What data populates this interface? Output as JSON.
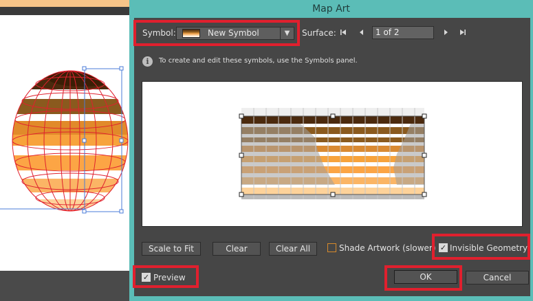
{
  "dialog": {
    "title": "Map Art",
    "symbol": {
      "label": "Symbol:",
      "value": "New Symbol"
    },
    "surface": {
      "label": "Surface:",
      "value": "1 of 2"
    },
    "info_text": "To create and edit these symbols, use the Symbols panel.",
    "buttons": {
      "scale_to_fit": "Scale to Fit",
      "clear": "Clear",
      "clear_all": "Clear All",
      "ok": "OK",
      "cancel": "Cancel"
    },
    "options": {
      "shade_artwork": {
        "label": "Shade Artwork (slower)",
        "checked": false
      },
      "invisible_geometry": {
        "label": "Invisible Geometry",
        "checked": true
      },
      "preview": {
        "label": "Preview",
        "checked": true
      }
    }
  },
  "icons": {
    "first": "first-surface-icon",
    "prev": "previous-surface-icon",
    "next": "next-surface-icon",
    "last": "last-surface-icon",
    "info": "info-icon",
    "dropdown": "chevron-down-icon"
  },
  "colors": {
    "dialog_frame": "#5bbdb7",
    "dialog_bg": "#464646",
    "highlight": "#e0202e",
    "mesh": "#e0202e",
    "selection": "#4a7bd8",
    "band_dark": "#4b2a0e",
    "band_brown": "#8a5a1e",
    "band_orange": "#f7a33c",
    "band_light": "#fdd29a"
  }
}
